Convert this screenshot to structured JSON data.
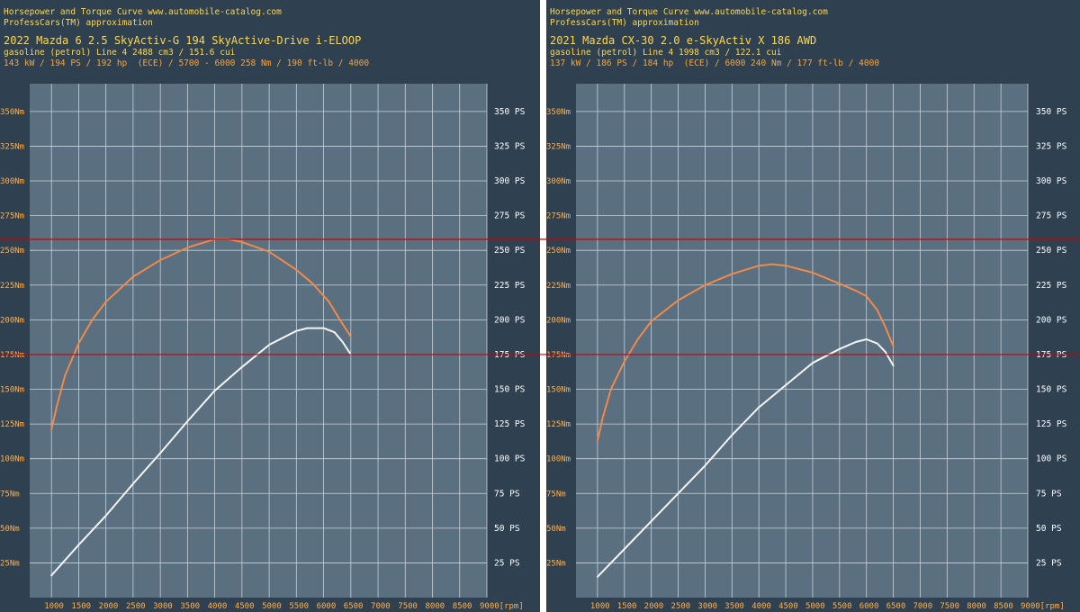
{
  "colors": {
    "panel_bg": "#2f4050",
    "plot_bg": "#5a6f7f",
    "grid": "#c8d2da",
    "tick_text": "#ffb04a",
    "torque_line": "#f08a4b",
    "power_line": "#f4f4f4",
    "reference_line": "#cc0000",
    "header_orange": "#f2a641",
    "header_yellow": "#ffd84a"
  },
  "panels": [
    {
      "header": {
        "site": "Horsepower and Torque Curve www.automobile-catalog.com",
        "approx": "ProfessCars(TM) approximation",
        "title": "2022 Mazda 6 2.5 SkyActiv-G 194 SkyActive-Drive i-ELOOP",
        "engine": "gasoline (petrol) Line 4 2488 cm3 / 151.6 cui",
        "specs": "143 kW / 194 PS / 192 hp  (ECE) / 5700 - 6000 258 Nm / 190 ft-lb / 4000"
      },
      "chart_data": {
        "type": "line",
        "x_unit": "rpm",
        "xlim": [
          600,
          9000
        ],
        "ylim": [
          0,
          370
        ],
        "x_ticks": [
          "1000",
          "1500",
          "2000",
          "2500",
          "3000",
          "3500",
          "4000",
          "4500",
          "5000",
          "5500",
          "6000",
          "6500",
          "7000",
          "7500",
          "8000",
          "8500",
          "9000[rpm]"
        ],
        "x_tick_values": [
          1000,
          1500,
          2000,
          2500,
          3000,
          3500,
          4000,
          4500,
          5000,
          5500,
          6000,
          6500,
          7000,
          7500,
          8000,
          8500,
          9000
        ],
        "y_left_ticks": [
          "25Nm",
          "50Nm",
          "75Nm",
          "100Nm",
          "125Nm",
          "150Nm",
          "175Nm",
          "200Nm",
          "225Nm",
          "250Nm",
          "275Nm",
          "300Nm",
          "325Nm",
          "350Nm"
        ],
        "y_right_ticks": [
          "25 PS",
          "50 PS",
          "75 PS",
          "100 PS",
          "125 PS",
          "150 PS",
          "175 PS",
          "200 PS",
          "225 PS",
          "250 PS",
          "275 PS",
          "300 PS",
          "325 PS",
          "350 PS"
        ],
        "y_tick_values": [
          25,
          50,
          75,
          100,
          125,
          150,
          175,
          200,
          225,
          250,
          275,
          300,
          325,
          350
        ],
        "series": [
          {
            "key": "torque",
            "x": [
              1000,
              1100,
              1250,
              1500,
              1750,
              2000,
              2500,
              3000,
              3500,
              4000,
              4250,
              4500,
              5000,
              5500,
              5800,
              6100,
              6300,
              6500
            ],
            "y": [
              121,
              138,
              160,
              183,
              200,
              213,
              231,
              243,
              252,
              258,
              258,
              256,
              249,
              236,
              226,
              213,
              200,
              188
            ]
          },
          {
            "key": "power",
            "x": [
              1000,
              1500,
              2000,
              2500,
              3000,
              3500,
              4000,
              4500,
              5000,
              5500,
              5700,
              6000,
              6200,
              6350,
              6500
            ],
            "y": [
              16,
              38,
              59,
              82,
              104,
              127,
              149,
              166,
              182,
              192,
              194,
              194,
              191,
              184,
              175
            ]
          }
        ]
      }
    },
    {
      "header": {
        "site": "Horsepower and Torque Curve www.automobile-catalog.com",
        "approx": "ProfessCars(TM) approximation",
        "title": "2021 Mazda CX-30 2.0 e-SkyActiv X 186 AWD",
        "engine": "gasoline (petrol) Line 4 1998 cm3 / 122.1 cui",
        "specs": "137 kW / 186 PS / 184 hp  (ECE) / 6000 240 Nm / 177 ft-lb / 4000"
      },
      "chart_data": {
        "type": "line",
        "x_unit": "rpm",
        "xlim": [
          600,
          9000
        ],
        "ylim": [
          0,
          370
        ],
        "x_ticks": [
          "1000",
          "1500",
          "2000",
          "2500",
          "3000",
          "3500",
          "4000",
          "4500",
          "5000",
          "5500",
          "6000",
          "6500",
          "7000",
          "7500",
          "8000",
          "8500",
          "9000[rpm]"
        ],
        "x_tick_values": [
          1000,
          1500,
          2000,
          2500,
          3000,
          3500,
          4000,
          4500,
          5000,
          5500,
          6000,
          6500,
          7000,
          7500,
          8000,
          8500,
          9000
        ],
        "y_left_ticks": [
          "25Nm",
          "50Nm",
          "75Nm",
          "100Nm",
          "125Nm",
          "150Nm",
          "175Nm",
          "200Nm",
          "225Nm",
          "250Nm",
          "275Nm",
          "300Nm",
          "325Nm",
          "350Nm"
        ],
        "y_right_ticks": [
          "25 PS",
          "50 PS",
          "75 PS",
          "100 PS",
          "125 PS",
          "150 PS",
          "175 PS",
          "200 PS",
          "225 PS",
          "250 PS",
          "275 PS",
          "300 PS",
          "325 PS",
          "350 PS"
        ],
        "y_tick_values": [
          25,
          50,
          75,
          100,
          125,
          150,
          175,
          200,
          225,
          250,
          275,
          300,
          325,
          350
        ],
        "series": [
          {
            "key": "torque",
            "x": [
              1000,
              1100,
              1250,
              1500,
              1750,
              2000,
              2500,
              3000,
              3500,
              4000,
              4250,
              4500,
              5000,
              5500,
              5800,
              6000,
              6200,
              6350,
              6500
            ],
            "y": [
              113,
              130,
              150,
              170,
              186,
              199,
              214,
              225,
              233,
              239,
              240,
              239,
              234,
              226,
              221,
              217,
              207,
              195,
              181
            ]
          },
          {
            "key": "power",
            "x": [
              1000,
              1500,
              2000,
              2500,
              3000,
              3500,
              4000,
              4500,
              5000,
              5500,
              5800,
              6000,
              6200,
              6350,
              6500
            ],
            "y": [
              15,
              35,
              55,
              75,
              95,
              117,
              137,
              153,
              169,
              179,
              184,
              186,
              183,
              177,
              167
            ]
          }
        ]
      }
    }
  ],
  "reference_lines": {
    "values": [
      258,
      175
    ]
  }
}
